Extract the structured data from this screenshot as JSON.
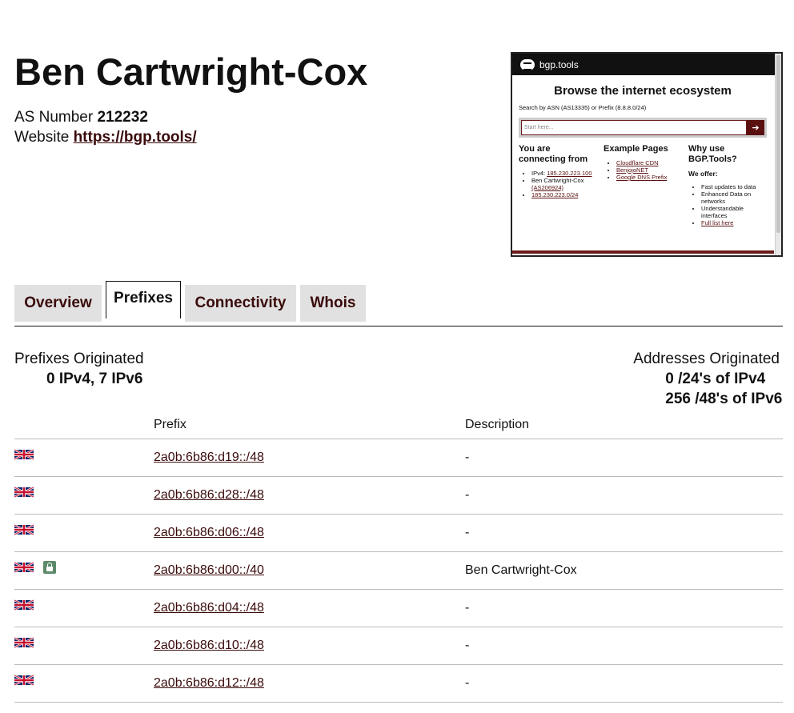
{
  "header": {
    "title": "Ben Cartwright-Cox",
    "as_label": "AS Number",
    "as_number": "212232",
    "website_label": "Website",
    "website": "https://bgp.tools/"
  },
  "preview": {
    "brand": "bgp.tools",
    "heading": "Browse the internet ecosystem",
    "hint": "Search by ASN (AS13335) or Prefix (8.8.8.0/24)",
    "search_placeholder": "Start here...",
    "go_icon": "arrow-right-icon",
    "col1": {
      "title": "You are connecting from",
      "ipv4_label": "IPv4:",
      "ipv4": "185.230.223.100",
      "org": "Ben Cartwright-Cox",
      "asn": "(AS206924)",
      "prefix": "185.230.223.0/24"
    },
    "col2": {
      "title": "Example Pages",
      "items": [
        "Cloudflare CDN",
        "BenjojoNET",
        "Google DNS Prefix"
      ]
    },
    "col3": {
      "title": "Why use BGP.Tools?",
      "offer": "We offer:",
      "items": [
        "Fast updates to data",
        "Enhanced Data on networks",
        "Understandable interfaces",
        "Full list here"
      ]
    }
  },
  "tabs": [
    "Overview",
    "Prefixes",
    "Connectivity",
    "Whois"
  ],
  "active_tab": "Prefixes",
  "stats": {
    "originated_label": "Prefixes Originated",
    "originated_value": "0 IPv4, 7 IPv6",
    "addresses_label": "Addresses Originated",
    "addresses_ipv4": "0 /24's of IPv4",
    "addresses_ipv6": "256 /48's of IPv6"
  },
  "table": {
    "headers": [
      "",
      "Prefix",
      "Description"
    ],
    "rows": [
      {
        "flag": "uk-flag-icon",
        "locked": false,
        "prefix": "2a0b:6b86:d19::/48",
        "description": "-"
      },
      {
        "flag": "uk-flag-icon",
        "locked": false,
        "prefix": "2a0b:6b86:d28::/48",
        "description": "-"
      },
      {
        "flag": "uk-flag-icon",
        "locked": false,
        "prefix": "2a0b:6b86:d06::/48",
        "description": "-"
      },
      {
        "flag": "uk-flag-icon",
        "locked": true,
        "prefix": "2a0b:6b86:d00::/40",
        "description": "Ben Cartwright-Cox"
      },
      {
        "flag": "uk-flag-icon",
        "locked": false,
        "prefix": "2a0b:6b86:d04::/48",
        "description": "-"
      },
      {
        "flag": "uk-flag-icon",
        "locked": false,
        "prefix": "2a0b:6b86:d10::/48",
        "description": "-"
      },
      {
        "flag": "uk-flag-icon",
        "locked": false,
        "prefix": "2a0b:6b86:d12::/48",
        "description": "-"
      }
    ]
  },
  "colors": {
    "link": "#3a0a0a",
    "accent": "#5a1010",
    "tab_inactive": "#e1e1e1",
    "lock": "#5c8a6a"
  }
}
